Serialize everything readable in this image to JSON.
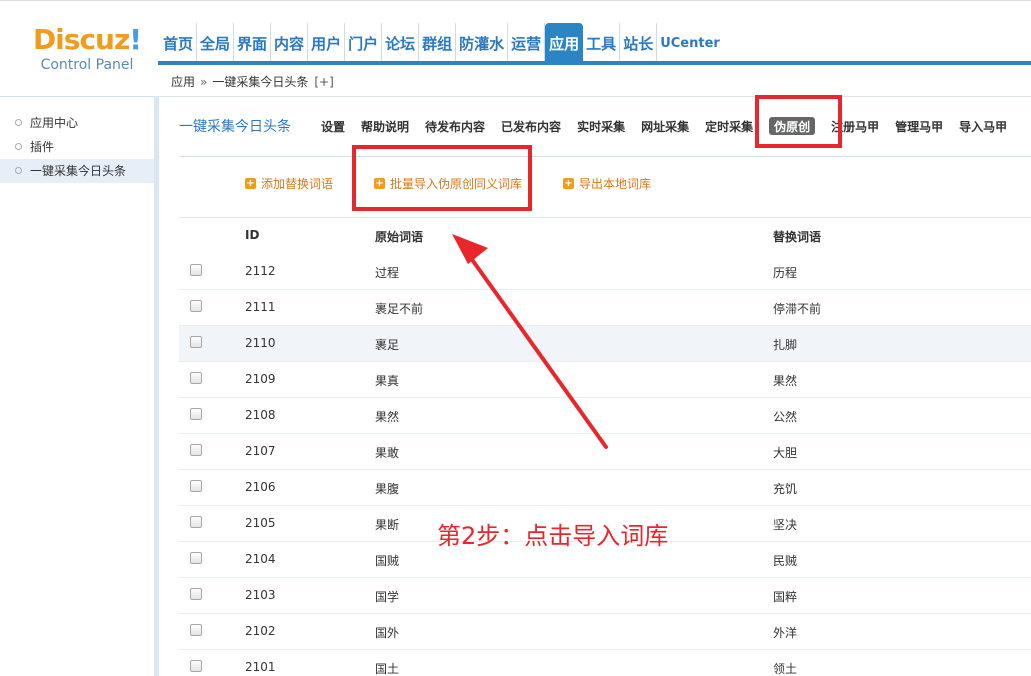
{
  "header": {
    "logo_word": "Discuz",
    "logo_bang": "!",
    "logo_sub": "Control Panel",
    "nav": [
      "首页",
      "全局",
      "界面",
      "内容",
      "用户",
      "门户",
      "论坛",
      "群组",
      "防灌水",
      "运营",
      "应用",
      "工具",
      "站长",
      "UCenter"
    ],
    "active_index": 10
  },
  "breadcrumb": {
    "root": "应用",
    "sep": "»",
    "current": "一键采集今日头条",
    "add": "[+]"
  },
  "sidebar": {
    "items": [
      {
        "label": "应用中心"
      },
      {
        "label": "插件"
      },
      {
        "label": "一键采集今日头条"
      }
    ]
  },
  "subnav": {
    "title": "一键采集今日头条",
    "links": [
      "设置",
      "帮助说明",
      "待发布内容",
      "已发布内容",
      "实时采集",
      "网址采集",
      "定时采集",
      "伪原创",
      "注册马甲",
      "管理马甲",
      "导入马甲"
    ],
    "active_label": "伪原创"
  },
  "actions": {
    "add": "添加替换词语",
    "batch_import": "批量导入伪原创同义词库",
    "export": "导出本地词库"
  },
  "table": {
    "headers": {
      "id": "ID",
      "original": "原始词语",
      "replacement": "替换词语"
    },
    "rows": [
      {
        "id": "2112",
        "original": "过程",
        "replacement": "历程"
      },
      {
        "id": "2111",
        "original": "裹足不前",
        "replacement": "停滞不前"
      },
      {
        "id": "2110",
        "original": "裹足",
        "replacement": "扎脚"
      },
      {
        "id": "2109",
        "original": "果真",
        "replacement": "果然"
      },
      {
        "id": "2108",
        "original": "果然",
        "replacement": "公然"
      },
      {
        "id": "2107",
        "original": "果敢",
        "replacement": "大胆"
      },
      {
        "id": "2106",
        "original": "果腹",
        "replacement": "充饥"
      },
      {
        "id": "2105",
        "original": "果断",
        "replacement": "坚决"
      },
      {
        "id": "2104",
        "original": "国贼",
        "replacement": "民贼"
      },
      {
        "id": "2103",
        "original": "国学",
        "replacement": "国粹"
      },
      {
        "id": "2102",
        "original": "国外",
        "replacement": "外洋"
      },
      {
        "id": "2101",
        "original": "国土",
        "replacement": "领土"
      }
    ]
  },
  "annotation": {
    "text": "第2步：点击导入词库",
    "color": "#e8262b"
  },
  "colors": {
    "brand_blue": "#2b85c5",
    "accent_orange": "#f29c1f",
    "annotation_red": "#e8262b"
  }
}
